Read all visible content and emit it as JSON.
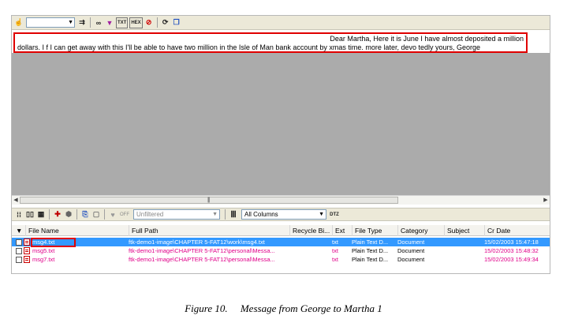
{
  "toolbar": {
    "combo_value": "",
    "buttons": [
      {
        "icon": "hand-icon",
        "glyph": "☝"
      },
      {
        "icon": "find-next-icon",
        "glyph": "⇉"
      },
      {
        "icon": "glasses-icon",
        "glyph": "∞"
      },
      {
        "icon": "filter-icon",
        "glyph": "▼"
      },
      {
        "icon": "text-view-icon",
        "glyph": "TXT"
      },
      {
        "icon": "hex-view-icon",
        "glyph": "HEX"
      },
      {
        "icon": "stop-icon",
        "glyph": "⊘"
      },
      {
        "icon": "refresh-icon",
        "glyph": "⟳"
      },
      {
        "icon": "copy-icon",
        "glyph": "❐"
      }
    ]
  },
  "viewer": {
    "line1": "Dear Martha, Here it is June I have almost deposited a million",
    "line2": "dollars. I f I can get away with this I'll be able to have two million in the Isle of Man bank account by xmas time. more later, devo tedly yours, George"
  },
  "list_toolbar": {
    "off_label": "OFF",
    "filter_value": "Unfiltered",
    "columns_value": "All Columns",
    "dtz_label": "DTZ"
  },
  "table": {
    "columns": [
      "File Name",
      "Full Path",
      "Recycle Bi...",
      "Ext",
      "File Type",
      "Category",
      "Subject",
      "Cr Date"
    ],
    "rows": [
      {
        "name": "msg4.txt",
        "path": "ftk-demo1-image\\CHAPTER 5-FAT12\\work\\msg4.txt",
        "recycle": "",
        "ext": "txt",
        "type": "Plain Text D...",
        "category": "Document",
        "subject": "",
        "date": "15/02/2003 15:47:18",
        "selected": true
      },
      {
        "name": "msg5.txt",
        "path": "ftk-demo1-image\\CHAPTER 5-FAT12\\personal\\Messa...",
        "recycle": "",
        "ext": "txt",
        "type": "Plain Text D...",
        "category": "Document",
        "subject": "",
        "date": "15/02/2003 15:48:32",
        "selected": false
      },
      {
        "name": "msg7.txt",
        "path": "ftk-demo1-image\\CHAPTER 5-FAT12\\personal\\Messa...",
        "recycle": "",
        "ext": "txt",
        "type": "Plain Text D...",
        "category": "Document",
        "subject": "",
        "date": "15/02/2003 15:49:34",
        "selected": false
      }
    ]
  },
  "caption": "Figure 10.     Message from George to Martha 1",
  "colors": {
    "highlight_border": "#e00000",
    "selected_row": "#3399ff",
    "pink_text": "#e0008a",
    "viewer_gray": "#ababab"
  }
}
